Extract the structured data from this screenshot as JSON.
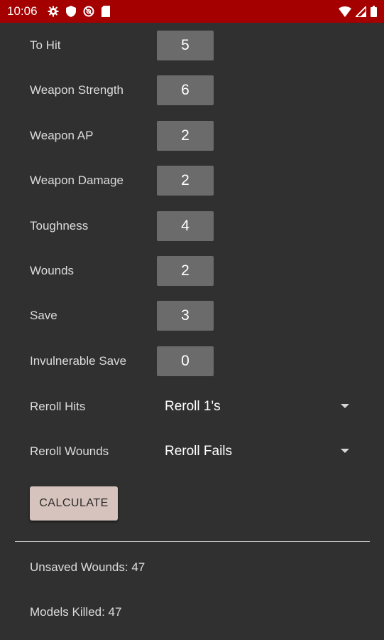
{
  "status_bar": {
    "time": "10:06",
    "left_icons": [
      "gear-icon",
      "shield-icon",
      "vpn-icon",
      "sd-card-icon"
    ],
    "right_icons": [
      "wifi-icon",
      "signal-icon",
      "battery-icon"
    ],
    "color": "#a50000"
  },
  "fields": [
    {
      "label": "To Hit",
      "value": "5"
    },
    {
      "label": "Weapon Strength",
      "value": "6"
    },
    {
      "label": "Weapon AP",
      "value": "2"
    },
    {
      "label": "Weapon Damage",
      "value": "2"
    },
    {
      "label": "Toughness",
      "value": "4"
    },
    {
      "label": "Wounds",
      "value": "2"
    },
    {
      "label": "Save",
      "value": "3"
    },
    {
      "label": "Invulnerable Save",
      "value": "0"
    }
  ],
  "dropdowns": [
    {
      "label": "Reroll Hits",
      "value": "Reroll 1's"
    },
    {
      "label": "Reroll Wounds",
      "value": "Reroll Fails"
    }
  ],
  "calculate_label": "CALCULATE",
  "results": {
    "unsaved_wounds": "Unsaved Wounds: 47",
    "models_killed": "Models Killed: 47"
  },
  "colors": {
    "background": "#303030",
    "input_box": "#6b6b6b",
    "button": "#d6c3bd"
  }
}
